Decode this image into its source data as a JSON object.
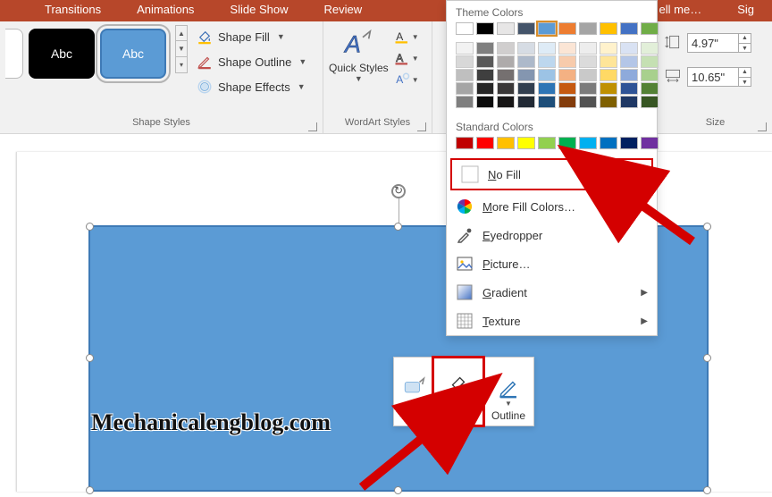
{
  "tabs": {
    "transitions": "Transitions",
    "animations": "Animations",
    "slideshow": "Slide Show",
    "review": "Review",
    "tellme": "ell me…",
    "sign": "Sig"
  },
  "ribbon": {
    "shape_styles": {
      "swatch_text": "Abc",
      "fill_label": "Shape Fill",
      "outline_label": "Shape Outline",
      "effects_label": "Shape Effects",
      "group_label": "Shape Styles"
    },
    "wordart": {
      "quick_styles": "Quick Styles",
      "group_label": "WordArt Styles"
    },
    "size": {
      "height": "4.97\"",
      "width": "10.65\"",
      "group_label": "Size"
    }
  },
  "color_popover": {
    "theme_title": "Theme Colors",
    "standard_title": "Standard Colors",
    "theme_row": [
      "#ffffff",
      "#000000",
      "#e7e6e6",
      "#44546a",
      "#5b9bd5",
      "#ed7d31",
      "#a5a5a5",
      "#ffc000",
      "#4472c4",
      "#70ad47"
    ],
    "shades": [
      [
        "#f2f2f2",
        "#7f7f7f",
        "#d0cece",
        "#d6dce4",
        "#deebf6",
        "#fbe5d5",
        "#ededed",
        "#fff2cc",
        "#d9e2f3",
        "#e2efd9"
      ],
      [
        "#d8d8d8",
        "#595959",
        "#aeabab",
        "#adb9ca",
        "#bdd7ee",
        "#f7cbac",
        "#dbdbdb",
        "#fee599",
        "#b4c6e7",
        "#c5e0b3"
      ],
      [
        "#bfbfbf",
        "#3f3f3f",
        "#757070",
        "#8496b0",
        "#9cc3e5",
        "#f4b183",
        "#c9c9c9",
        "#ffd965",
        "#8eaadb",
        "#a8d08d"
      ],
      [
        "#a5a5a5",
        "#262626",
        "#3a3838",
        "#323f4f",
        "#2e75b5",
        "#c55a11",
        "#7b7b7b",
        "#bf9000",
        "#2f5496",
        "#538135"
      ],
      [
        "#7f7f7f",
        "#0c0c0c",
        "#171616",
        "#222a35",
        "#1e4e79",
        "#833c0b",
        "#525252",
        "#7f6000",
        "#1f3864",
        "#375623"
      ]
    ],
    "standard_row": [
      "#c00000",
      "#ff0000",
      "#ffc000",
      "#ffff00",
      "#92d050",
      "#00b050",
      "#00b0f0",
      "#0070c0",
      "#002060",
      "#7030a0"
    ],
    "no_fill": "No Fill",
    "more_colors": "More Fill Colors…",
    "eyedropper": "Eyedropper",
    "picture": "Picture…",
    "gradient": "Gradient",
    "texture": "Texture"
  },
  "mini_toolbar": {
    "style": "Style",
    "fill": "Fill",
    "outline": "Outline"
  },
  "watermark": "Mechanicalengblog.com"
}
